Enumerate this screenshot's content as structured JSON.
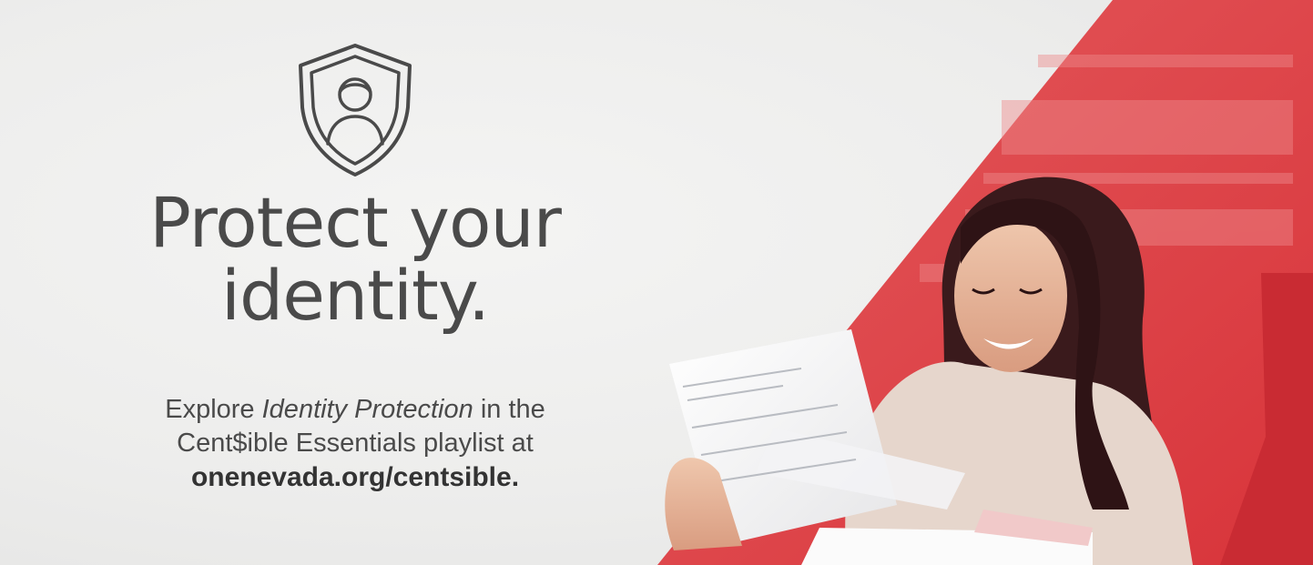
{
  "banner": {
    "headline_line1": "Protect your",
    "headline_line2": "identity.",
    "body_prefix": "Explore ",
    "body_emphasis": "Identity Protection",
    "body_suffix": " in the",
    "body_line2": "Cent$ible Essentials playlist at",
    "url": "onenevada.org/centsible."
  },
  "icons": {
    "badge": "shield-person-icon"
  },
  "colors": {
    "background": "#ededec",
    "text": "#4a4a4a",
    "accent_red": "#e0393f"
  }
}
